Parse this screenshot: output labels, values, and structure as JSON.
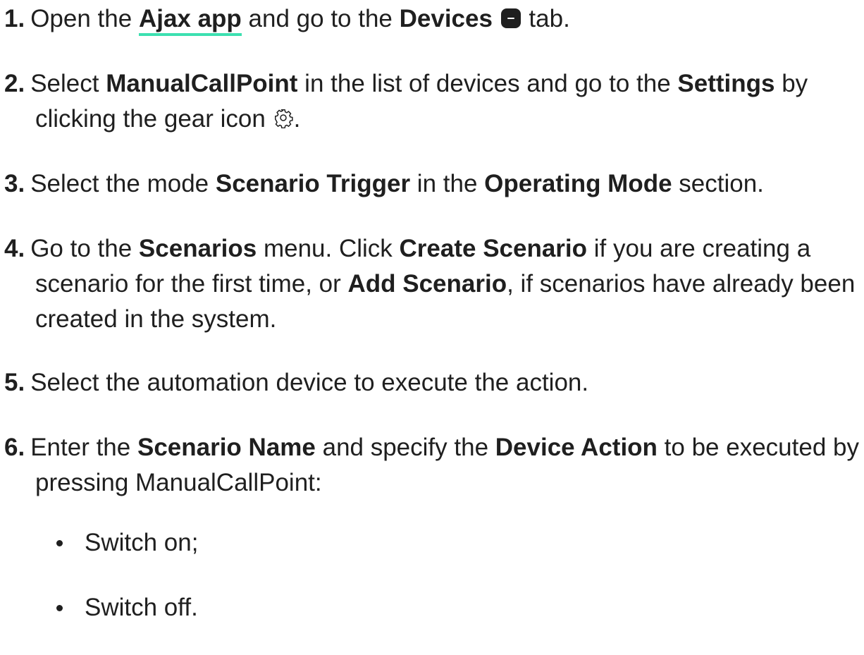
{
  "steps": [
    {
      "num": "1.",
      "parts": {
        "a": "Open the ",
        "link": "Ajax app",
        "b": " and go to the ",
        "bold1": "Devices",
        "c": " tab."
      },
      "icon": "devices-icon"
    },
    {
      "num": "2.",
      "parts": {
        "a": "Select ",
        "bold1": "ManualCallPoint",
        "b": " in the list of devices and go to the ",
        "bold2": "Settings",
        "c": " by",
        "line2": "clicking the gear icon ",
        "d": "."
      },
      "icon": "gear-icon"
    },
    {
      "num": "3.",
      "parts": {
        "a": "Select the mode ",
        "bold1": "Scenario Trigger",
        "b": " in the ",
        "bold2": "Operating Mode",
        "c": " section."
      }
    },
    {
      "num": "4.",
      "parts": {
        "a": "Go to the ",
        "bold1": "Scenarios",
        "b": " menu. Click ",
        "bold2": "Create Scenario",
        "c": " if you are creating a",
        "line2a": "scenario for the first time, or ",
        "bold3": "Add Scenario",
        "line2b": ", if scenarios have already been",
        "line3": "created in the system."
      }
    },
    {
      "num": "5.",
      "parts": {
        "a": "Select the automation device to execute the action."
      }
    },
    {
      "num": "6.",
      "parts": {
        "a": "Enter the ",
        "bold1": "Scenario Name",
        "b": " and specify the ",
        "bold2": "Device Action",
        "c": " to be executed by",
        "line2": "pressing ManualCallPoint:"
      }
    }
  ],
  "bullets": [
    "Switch on;",
    "Switch off."
  ],
  "colors": {
    "link_underline": "#3ce0b0",
    "text": "#1f1f1f"
  }
}
